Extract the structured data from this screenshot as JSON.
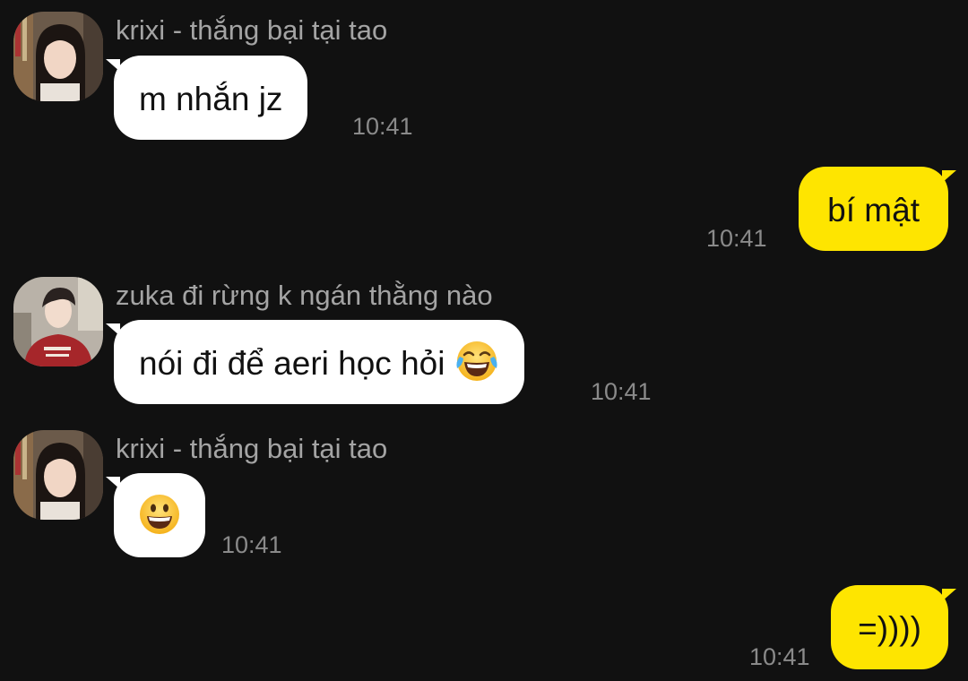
{
  "messages": [
    {
      "direction": "incoming",
      "sender": "krixi - thắng bại tại tao",
      "avatar": "profile-photo-girl",
      "text": "m nhắn jz",
      "time": "10:41"
    },
    {
      "direction": "outgoing",
      "text": "bí mật",
      "time": "10:41"
    },
    {
      "direction": "incoming",
      "sender": "zuka đi rừng k ngán thằng nào",
      "avatar": "profile-photo-boy-red-hoodie",
      "text": "nói đi để aeri học hỏi",
      "emoji": "face-with-tears-of-joy",
      "time": "10:41"
    },
    {
      "direction": "incoming",
      "sender": "krixi - thắng bại tại tao",
      "avatar": "profile-photo-girl",
      "emoji": "grinning-face",
      "time": "10:41"
    },
    {
      "direction": "outgoing",
      "text": "=))))",
      "time": "10:41"
    }
  ],
  "colors": {
    "background": "#111111",
    "incoming_bubble": "#ffffff",
    "outgoing_bubble": "#fee500",
    "sender_name": "#a4a4a4",
    "timestamp": "#8a8a8a"
  }
}
